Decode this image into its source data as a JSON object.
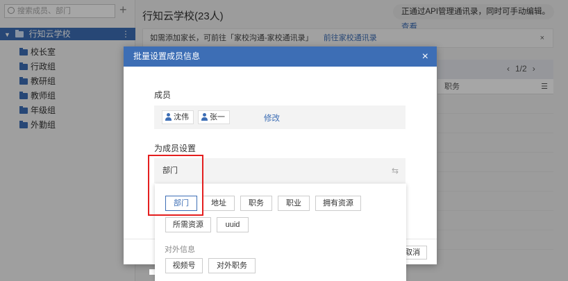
{
  "sidebar": {
    "search_placeholder": "搜索成员、部门",
    "add_icon": "plus-icon",
    "root": {
      "label": "行知云学校",
      "menu": "⋮"
    },
    "items": [
      {
        "label": "校长室"
      },
      {
        "label": "行政组"
      },
      {
        "label": "教研组"
      },
      {
        "label": "教师组"
      },
      {
        "label": "年级组"
      },
      {
        "label": "外勤组"
      }
    ]
  },
  "main": {
    "title": "行知云学校(23人)",
    "api_note": "正通过API管理通讯录，同时可手动编辑。",
    "api_note_link": "查看",
    "notice": "如需添加家长，可前往「家校沟通-家校通讯录」",
    "notice_link": "前往家校通讯录",
    "notice_close": "×",
    "pager": "1/2",
    "pager_prev": "‹",
    "pager_next": "›",
    "col_header": "职务",
    "col_menu": "☰"
  },
  "modal": {
    "title": "批量设置成员信息",
    "close": "×",
    "members_label": "成员",
    "members": [
      {
        "name": "沈伟"
      },
      {
        "name": "张一"
      }
    ],
    "edit_link": "修改",
    "set_label": "为成员设置",
    "selected_field": "部门",
    "swap_icon": "⇆",
    "cancel": "取消"
  },
  "dropdown": {
    "options_row1": [
      "部门",
      "地址",
      "职务",
      "职业",
      "拥有资源"
    ],
    "options_row2": [
      "所需资源",
      "uuid"
    ],
    "group_label": "对外信息",
    "options_row3": [
      "视频号",
      "对外职务"
    ]
  },
  "colors": {
    "accent": "#3d6eb5",
    "highlight": "#e41e1e"
  }
}
